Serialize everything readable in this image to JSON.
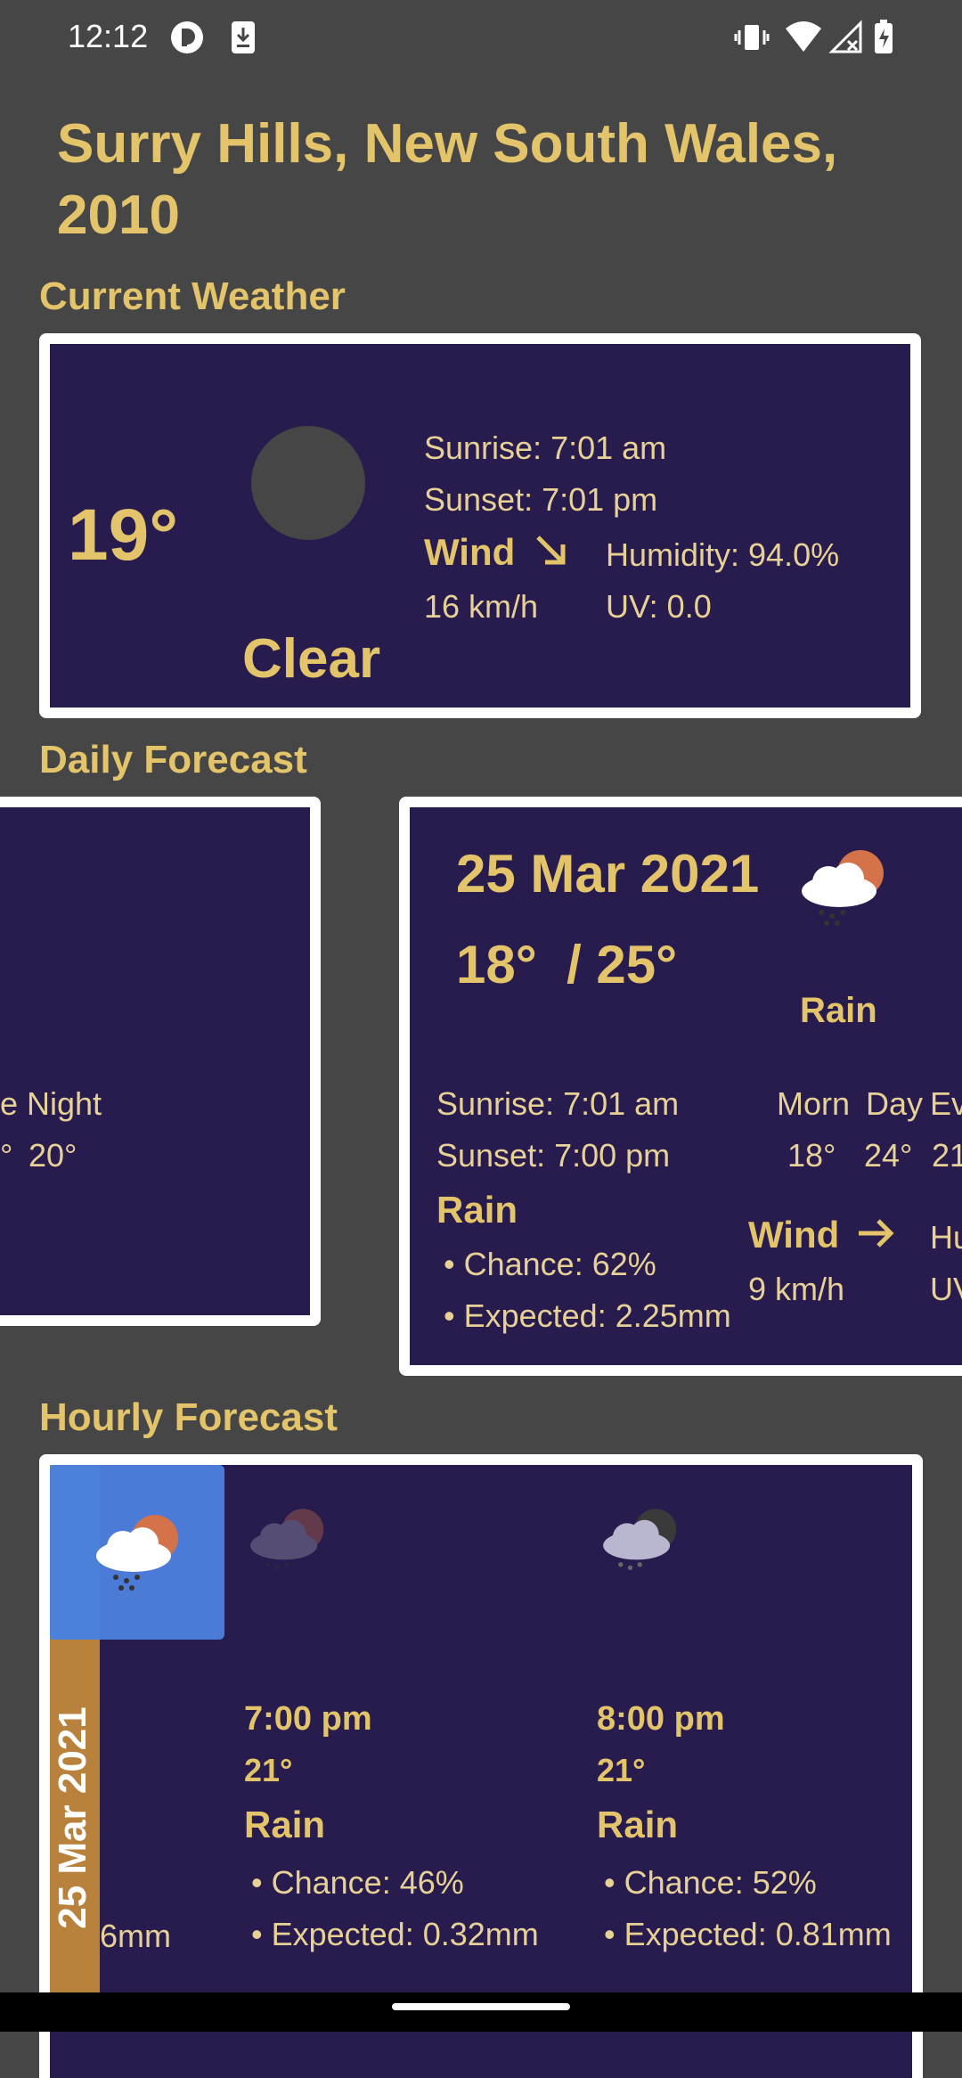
{
  "status_bar": {
    "time": "12:12"
  },
  "location": {
    "title_line1": "Surry Hills, New South Wales,",
    "title_line2": "2010"
  },
  "current": {
    "section_title": "Current Weather",
    "temp": "19°",
    "condition": "Clear",
    "sunrise": "Sunrise: 7:01 am",
    "sunset": "Sunset: 7:01 pm",
    "wind_label": "Wind",
    "wind_speed": "16 km/h",
    "humidity": "Humidity: 94.0%",
    "uv": "UV: 0.0"
  },
  "daily": {
    "section_title": "Daily Forecast",
    "prev_card": {
      "label_partial": "e",
      "night_label": "Night",
      "temp_partial": "°",
      "night_temp": "20°"
    },
    "card": {
      "date": "25 Mar 2021",
      "temp_range": "18°  / 25°",
      "condition": "Rain",
      "sunrise": "Sunrise: 7:01 am",
      "sunset": "Sunset: 7:00 pm",
      "rain_title": "Rain",
      "rain_chance": "• Chance: 62%",
      "rain_expected": "• Expected: 2.25mm",
      "morn_label": "Morn",
      "day_label": "Day",
      "eve_label": "Ev",
      "morn_temp": "18°",
      "day_temp": "24°",
      "eve_temp": "21",
      "wind_label": "Wind",
      "wind_speed": "9 km/h",
      "hum_partial": "Hu",
      "uv_partial": "UV"
    }
  },
  "hourly": {
    "section_title": "Hourly Forecast",
    "date_tab": "25 Mar 2021",
    "partial_expected": "6mm",
    "items": [
      {
        "time": "7:00 pm",
        "temp": "21°",
        "condition": "Rain",
        "chance": "• Chance: 46%",
        "expected": "• Expected: 0.32mm"
      },
      {
        "time": "8:00 pm",
        "temp": "21°",
        "condition": "Rain",
        "chance": "• Chance: 52%",
        "expected": "• Expected: 0.81mm"
      }
    ]
  }
}
